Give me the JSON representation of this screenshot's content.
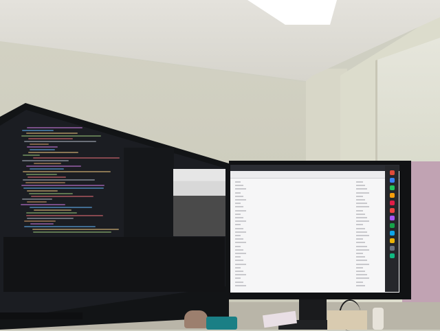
{
  "scene": {
    "description_colors": {
      "wall": "#d3d2c4",
      "ceiling": "#e4e2dc",
      "pink_panel": "#c1a3b3",
      "editor_bg": "#1b1d22",
      "browser_bg": "#f6f6f7",
      "teal_pad": "#1a7f85"
    }
  },
  "left_monitor": {
    "code_line_colors": [
      "#c678dd",
      "#61afef",
      "#e5c07b",
      "#98c379",
      "#e06c75",
      "#abb2bf",
      "#d19a66"
    ]
  },
  "right_monitor": {
    "dock_icon_colors": [
      "#e04b3a",
      "#3b82f6",
      "#22c55e",
      "#f59e0b",
      "#e11d48",
      "#ef4444",
      "#a855f7",
      "#16a34a",
      "#0ea5e9",
      "#eab308",
      "#6b7280",
      "#10b981"
    ]
  }
}
